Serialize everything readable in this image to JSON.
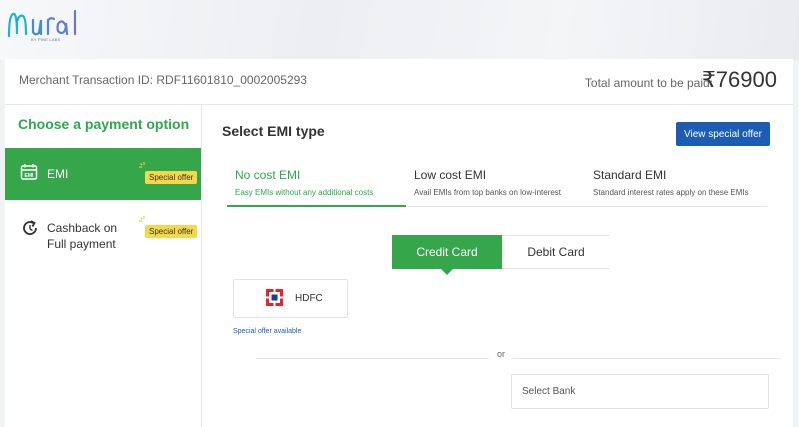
{
  "brand": {
    "name": "nural",
    "tagline": "BY PINE LABS"
  },
  "header": {
    "merchant_transaction_id": "Merchant Transaction ID: RDF11601810_0002005293",
    "total_label": "Total amount to be paid:",
    "total_amount": "₹76900"
  },
  "sidebar": {
    "title": "Choose a payment option",
    "options": [
      {
        "label": "EMI",
        "badge": "Special offer",
        "selected": true,
        "icon": "calendar-icon"
      },
      {
        "label": "Cashback on\nFull payment",
        "badge": "Special offer",
        "selected": false,
        "icon": "refresh-icon"
      }
    ]
  },
  "main": {
    "title": "Select EMI type",
    "view_offer_label": "View special offer",
    "emi_tabs": [
      {
        "title": "No cost EMI",
        "subtitle": "Easy EMIs without any additional costs",
        "active": true
      },
      {
        "title": "Low cost EMI",
        "subtitle": "Avail EMIs from top banks on low-interest",
        "active": false
      },
      {
        "title": "Standard EMI",
        "subtitle": "Standard interest rates apply on these EMIs",
        "active": false
      }
    ],
    "card_type": {
      "credit": "Credit Card",
      "debit": "Debit Card",
      "selected": "credit"
    },
    "bank": {
      "name": "HDFC",
      "note": "Special offer available"
    },
    "separator": "or",
    "select_bank_placeholder": "Select Bank"
  },
  "colors": {
    "accent_green": "#36a64a",
    "accent_blue": "#1d5cb5",
    "badge_yellow": "#f5d84a",
    "hdfc_red": "#e2262c",
    "hdfc_navy": "#1c3f8c"
  }
}
